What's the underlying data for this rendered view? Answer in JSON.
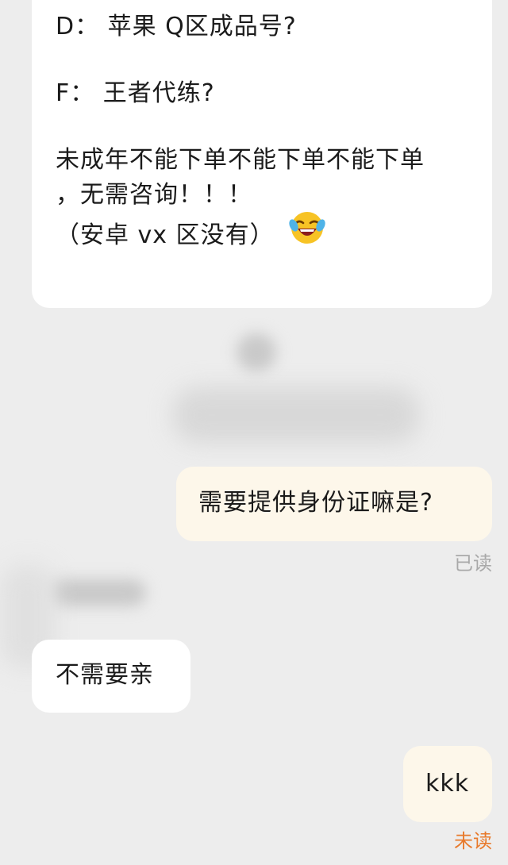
{
  "messages": {
    "top": {
      "line_d": "D： 苹果  Q区成品号?",
      "line_f": "F： 王者代练?",
      "line_warn_1": "未成年不能下单不能下单不能下单",
      "line_warn_2": "，无需咨询！！！",
      "line_note": "（安卓 vx 区没有）",
      "emoji": "laughing-crying-emoji-icon"
    },
    "id_question": "需要提供身份证嘛是?",
    "id_question_status": "已读",
    "reply_no_need": "不需要亲",
    "kkk": "kkk",
    "kkk_status": "未读"
  },
  "colors": {
    "background": "#ededed",
    "incoming_bubble": "#ffffff",
    "outgoing_bubble": "#fdf7ea",
    "read_status": "#a9a9a9",
    "unread_status": "#e87a2c"
  }
}
